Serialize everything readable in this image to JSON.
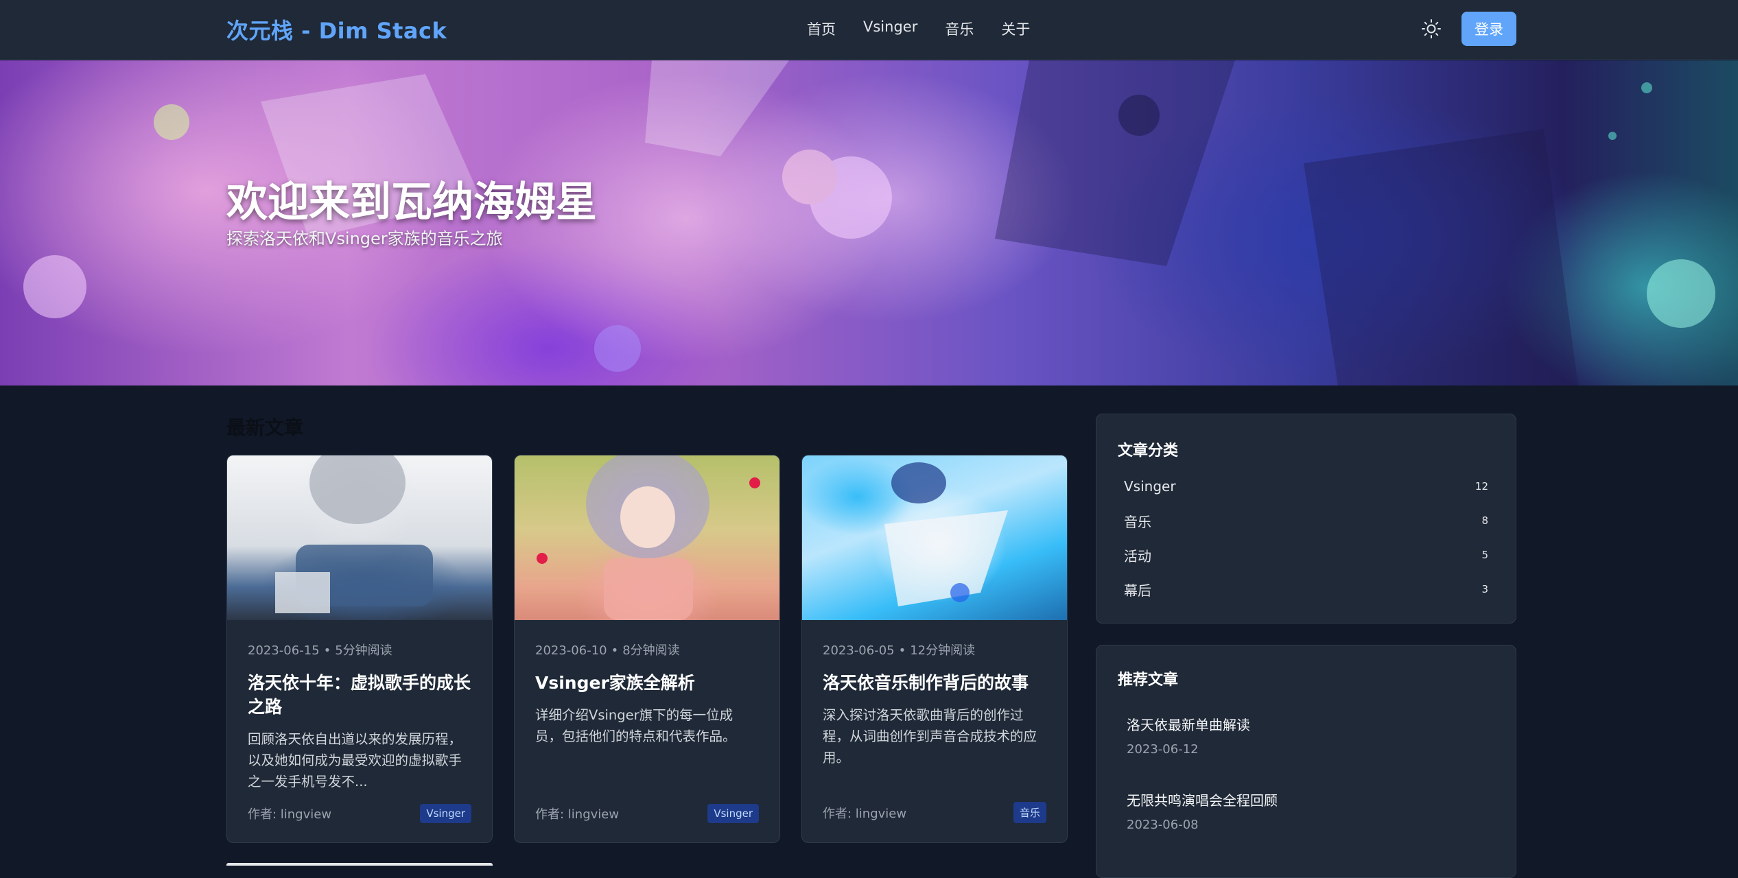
{
  "header": {
    "brand": "次元栈 - Dim Stack",
    "nav": [
      "首页",
      "Vsinger",
      "音乐",
      "关于"
    ],
    "theme_icon": "sun-icon",
    "login_label": "登录"
  },
  "hero": {
    "title": "欢迎来到瓦纳海姆星",
    "subtitle": "探索洛天依和Vsinger家族的音乐之旅"
  },
  "main": {
    "section_title": "最新文章",
    "articles": [
      {
        "date": "2023-06-15",
        "read_time": "5分钟阅读",
        "title": "洛天依十年：虚拟歌手的成长之路",
        "desc": "回顾洛天依自出道以来的发展历程，以及她如何成为最受欢迎的虚拟歌手之一发手机号发不...",
        "author": "作者: lingview",
        "tag": "Vsinger"
      },
      {
        "date": "2023-06-10",
        "read_time": "8分钟阅读",
        "title": "Vsinger家族全解析",
        "desc": "详细介绍Vsinger旗下的每一位成员，包括他们的特点和代表作品。",
        "author": "作者: lingview",
        "tag": "Vsinger"
      },
      {
        "date": "2023-06-05",
        "read_time": "12分钟阅读",
        "title": "洛天依音乐制作背后的故事",
        "desc": "深入探讨洛天依歌曲背后的创作过程，从词曲创作到声音合成技术的应用。",
        "author": "作者: lingview",
        "tag": "音乐"
      }
    ]
  },
  "sidebar": {
    "categories_title": "文章分类",
    "categories": [
      {
        "name": "Vsinger",
        "count": "12"
      },
      {
        "name": "音乐",
        "count": "8"
      },
      {
        "name": "活动",
        "count": "5"
      },
      {
        "name": "幕后",
        "count": "3"
      }
    ],
    "recommended_title": "推荐文章",
    "recommended": [
      {
        "title": "洛天依最新单曲解读",
        "date": "2023-06-12"
      },
      {
        "title": "无限共鸣演唱会全程回顾",
        "date": "2023-06-08"
      }
    ]
  },
  "colors": {
    "accent": "#60a5fa",
    "page_bg": "#111827",
    "surface": "#1f2937",
    "tag_bg": "#1e3a8a"
  }
}
